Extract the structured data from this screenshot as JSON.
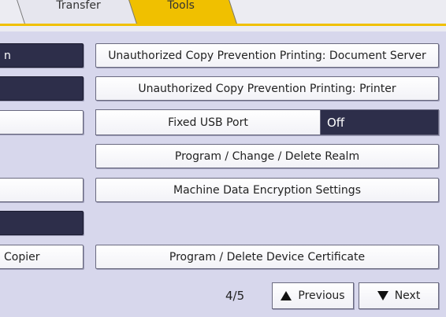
{
  "tabs": [
    {
      "label": "Transfer"
    },
    {
      "label": "Tools"
    }
  ],
  "left_column": [
    {
      "label": "n"
    },
    {
      "label": ""
    },
    {
      "label": ""
    },
    {
      "label": ""
    },
    {
      "label": ""
    },
    {
      "label": "Copier"
    }
  ],
  "settings": {
    "copy_prevention_doc_server": "Unauthorized Copy Prevention Printing: Document Server",
    "copy_prevention_printer": "Unauthorized Copy Prevention Printing: Printer",
    "fixed_usb_port": {
      "label": "Fixed USB Port",
      "value": "Off"
    },
    "realm": "Program / Change / Delete Realm",
    "encryption": "Machine Data Encryption Settings",
    "device_certificate": "Program / Delete Device Certificate"
  },
  "pagination": {
    "page": "4/5",
    "previous_label": "Previous",
    "next_label": "Next"
  },
  "colors": {
    "accent": "#f0c000",
    "selected_dark": "#2d2e4a",
    "background": "#d7d7ec"
  }
}
